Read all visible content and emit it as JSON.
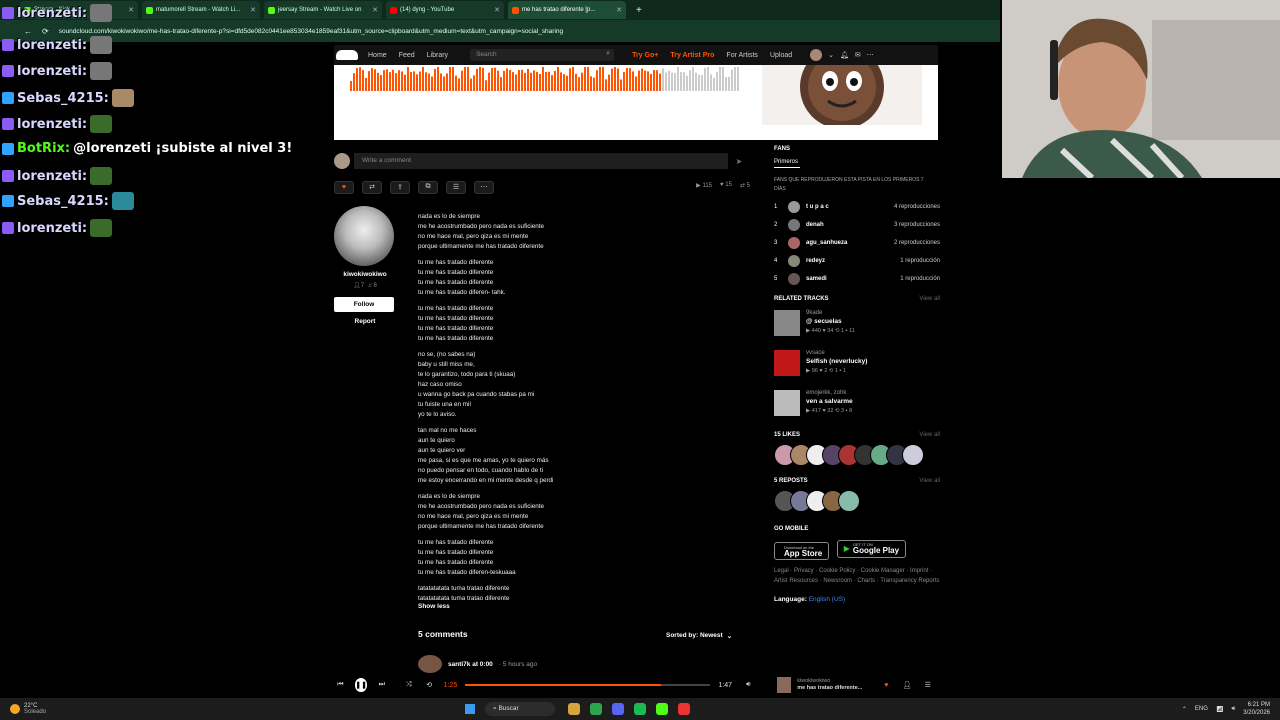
{
  "browser": {
    "tabs": [
      {
        "label": "Stream - Kick",
        "color": "#53fc18"
      },
      {
        "label": "matumorell Stream - Watch Li...",
        "color": "#53fc18"
      },
      {
        "label": "jeersay Stream - Watch Live on",
        "color": "#53fc18"
      },
      {
        "label": "(14) dyng - YouTube",
        "color": "#ff0000"
      },
      {
        "label": "me has tratao diferente [p...",
        "color": "#ff5500"
      }
    ],
    "new_tab": "+",
    "url": "soundcloud.com/kiwokiwokiwo/me-has-tratao-diferente-p?si=dfd5de082c0441ee853034e1859eaf31&utm_source=clipboard&utm_medium=text&utm_campaign=social_sharing"
  },
  "chat": [
    {
      "user": "lorenzeti:",
      "message": "",
      "color": "#d8d8ff",
      "badge": "#8a5cf5",
      "emote": "#777"
    },
    {
      "user": "lorenzeti:",
      "message": "",
      "color": "#d8d8ff",
      "badge": "#8a5cf5",
      "emote": "#777"
    },
    {
      "user": "lorenzeti:",
      "message": "",
      "color": "#d8d8ff",
      "badge": "#8a5cf5",
      "emote": "#777"
    },
    {
      "user": "Sebas_4215:",
      "message": "",
      "color": "#d8d8ff",
      "badge": "#2fa3ff",
      "emote": "#a98a66"
    },
    {
      "user": "lorenzeti:",
      "message": "",
      "color": "#d8d8ff",
      "badge": "#8a5cf5",
      "emote": "#3a6b2a"
    },
    {
      "user": "BotRix:",
      "message": "@lorenzeti ¡subiste al nivel 3!",
      "color": "#53fc18",
      "badge": "#2fa3ff",
      "emote": ""
    },
    {
      "user": "lorenzeti:",
      "message": "",
      "color": "#d8d8ff",
      "badge": "#8a5cf5",
      "emote": "#3a6b2a"
    },
    {
      "user": "Sebas_4215:",
      "message": "",
      "color": "#d8d8ff",
      "badge": "#2fa3ff",
      "emote": "#2a8a9a"
    },
    {
      "user": "lorenzeti:",
      "message": "",
      "color": "#d8d8ff",
      "badge": "#8a5cf5",
      "emote": "#3a6b2a"
    }
  ],
  "header": {
    "nav": [
      "Home",
      "Feed",
      "Library"
    ],
    "search_placeholder": "Search",
    "try_go": "Try Go+",
    "try_artist": "Try Artist Pro",
    "for_artists": "For Artists",
    "upload": "Upload"
  },
  "comment_input": {
    "placeholder": "Write a comment"
  },
  "stats": {
    "plays": "115",
    "likes": "15",
    "reposts": "5"
  },
  "uploader": {
    "name": "kiwokiwokiwo",
    "followers": "7",
    "tracks": "8",
    "follow": "Follow",
    "report": "Report"
  },
  "lyrics": [
    [
      "nada es lo de siempre",
      "me he acostrumbado pero nada es suficiente",
      "no me hace mal, pero qiza es mi mente",
      "porque ultimamente me has tratado diferente"
    ],
    [
      "tu me has tratado diferente",
      "tu me has tratado diferente",
      "tu me has tratado diferente",
      "tu me has tratado diferen- tahk."
    ],
    [
      "tu me has tratado diferente",
      "tu me has tratado diferente",
      "tu me has tratado diferente",
      "tu me has tratado diferente"
    ],
    [
      "no se, (no sabes na)",
      "baby u still miss me,",
      "te lo garantizo, todo para ti (skuaa)",
      "haz caso omiso",
      "u wanna go back pa cuando stabas pa mi",
      "tu fuiste una en mil",
      "yo te lo aviso."
    ],
    [
      "tan mal no me haces",
      "aun te quiero",
      "aun te quiero ver",
      "me pasa, si es que me amas, yo te quiero más",
      "no puedo pensar en todo, cuando hablo de ti",
      "me estoy encerrando en mi mente desde q perdi"
    ],
    [
      "nada es lo de siempre",
      "me he acostrumbado pero nada es suficiente",
      "no me hace mal, pero qiza es mi mente",
      "porque ultimamente me has tratado diferente"
    ],
    [
      "tu me has tratado diferente",
      "tu me has tratado diferente",
      "tu me has tratado diferente",
      "tu me has tratado diferen-teskuaaa"
    ],
    [
      "tatatatatata tuma tratao diferente",
      "tatatatatata tuma tratao diferente"
    ]
  ],
  "show_less": "Show less",
  "comments": {
    "title": "5 comments",
    "sort": "Sorted by: Newest",
    "first_user": "santi7k at 0:00",
    "first_time": "· 5 hours ago"
  },
  "fans": {
    "title": "FANS",
    "tab": "Primeros",
    "subtitle": "FANS QUE REPRODUJERON ESTA PISTA EN LOS PRIMEROS 7 DÍAS",
    "items": [
      {
        "rank": "1",
        "name": "t u p a c",
        "plays": "4 reproducciones"
      },
      {
        "rank": "2",
        "name": "denah",
        "plays": "3 reproducciones"
      },
      {
        "rank": "3",
        "name": "agu_sanhueza",
        "plays": "2 reproducciones"
      },
      {
        "rank": "4",
        "name": "redeyz",
        "plays": "1 reproducción"
      },
      {
        "rank": "5",
        "name": "samedi",
        "plays": "1 reproducción"
      }
    ]
  },
  "related": {
    "title": "RELATED TRACKS",
    "view_all": "View all",
    "items": [
      {
        "artist": "9kade",
        "title": "@ secuelas",
        "stats": "▶ 440  ♥ 34  ⟲ 1  ▪ 11",
        "color": "#888"
      },
      {
        "artist": "vvsace",
        "title": "Selfish (neverlucky)",
        "stats": "▶ 96  ♥ 2  ⟲ 1  ▪ 1",
        "color": "#c01818"
      },
      {
        "artist": "emojerkk, zohk",
        "title": "ven a salvarme",
        "stats": "▶ 417  ♥ 32  ⟲ 3  ▪ 8",
        "color": "#bbb"
      }
    ]
  },
  "likes": {
    "title": "15 LIKES",
    "view_all": "View all",
    "colors": [
      "#c9a",
      "#a86",
      "#eee",
      "#546",
      "#a33",
      "#333",
      "#6a8",
      "#334",
      "#ccd"
    ]
  },
  "reposts": {
    "title": "5 REPOSTS",
    "view_all": "View all",
    "colors": [
      "#555",
      "#779",
      "#eee",
      "#864",
      "#8ba"
    ]
  },
  "mobile": {
    "title": "GO MOBILE",
    "app_store_small": "Download on the",
    "app_store": "App Store",
    "play_small": "GET IT ON",
    "play": "Google Play"
  },
  "footer": {
    "links": "Legal · Privacy · Cookie Policy · Cookie Manager · Imprint · Artist Resources · Newsroom · Charts · Transparency Reports",
    "language_label": "Language:",
    "language": "English (US)"
  },
  "player": {
    "elapsed": "1:25",
    "duration": "1:47",
    "progress": 0.8,
    "artist": "kiwokiwokiwo",
    "title": "me has tratao diferente..."
  },
  "taskbar": {
    "temp": "22°C",
    "condition": "Soleado",
    "search": "Buscar",
    "lang": "ENG",
    "time": "6:21 PM",
    "date": "3/20/2026"
  }
}
